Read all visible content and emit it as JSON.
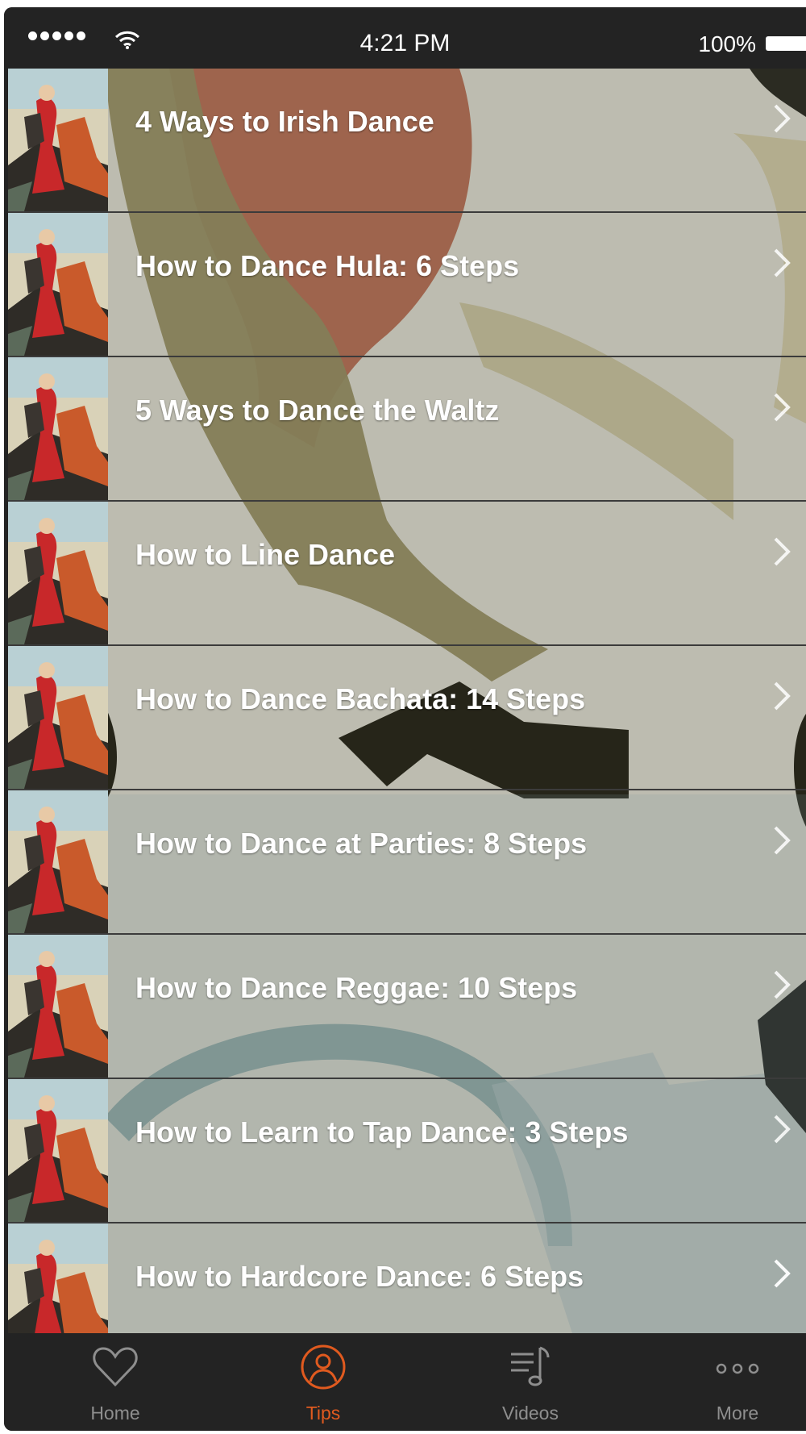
{
  "status_bar": {
    "time": "4:21 PM",
    "battery": "100%"
  },
  "list": {
    "items": [
      {
        "title": "4 Ways to Irish Dance"
      },
      {
        "title": "How to Dance Hula: 6 Steps"
      },
      {
        "title": "5 Ways to Dance the Waltz"
      },
      {
        "title": "How to Line Dance"
      },
      {
        "title": "How to Dance Bachata: 14 Steps"
      },
      {
        "title": "How to Dance at Parties: 8 Steps"
      },
      {
        "title": "How to Dance Reggae: 10 Steps"
      },
      {
        "title": "How to Learn to Tap Dance: 3 Steps"
      },
      {
        "title": "How to Hardcore Dance: 6 Steps"
      }
    ]
  },
  "tab_bar": {
    "tabs": [
      {
        "label": "Home",
        "icon": "heart-icon",
        "active": false
      },
      {
        "label": "Tips",
        "icon": "person-icon",
        "active": true
      },
      {
        "label": "Videos",
        "icon": "music-list-icon",
        "active": false
      },
      {
        "label": "More",
        "icon": "more-dots-icon",
        "active": false
      }
    ]
  },
  "colors": {
    "active_tab": "#e05a1f",
    "inactive_tab": "#8e8e8e",
    "bar_background": "#232323"
  }
}
